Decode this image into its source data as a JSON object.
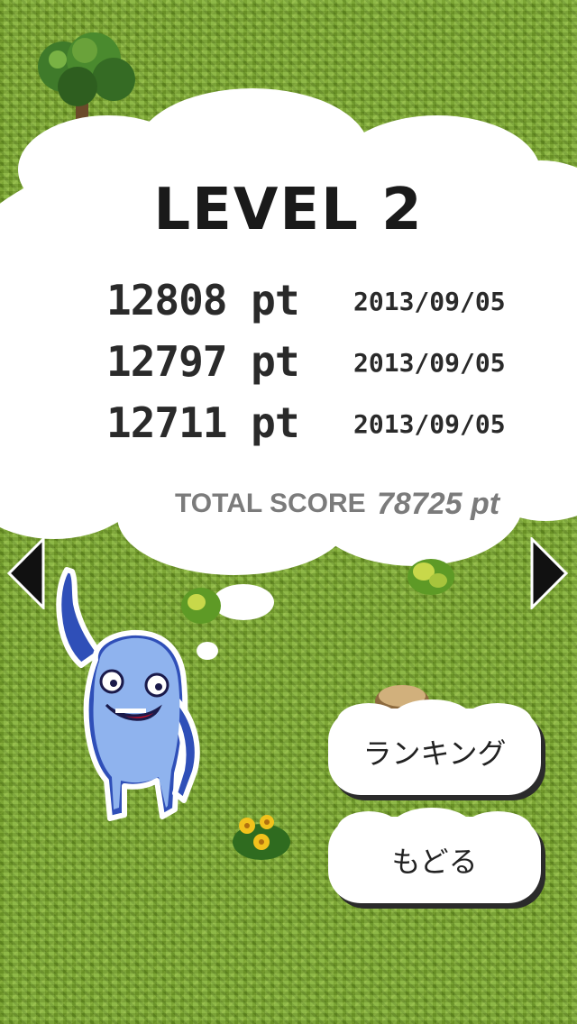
{
  "level": {
    "title": "LEVEL 2"
  },
  "scores": [
    {
      "value": "12808 pt",
      "date": "2013/09/05"
    },
    {
      "value": "12797 pt",
      "date": "2013/09/05"
    },
    {
      "value": "12711 pt",
      "date": "2013/09/05"
    }
  ],
  "total": {
    "label": "TOTAL SCORE",
    "value": "78725 pt"
  },
  "buttons": {
    "ranking": "ランキング",
    "back": "もどる"
  },
  "icons": {
    "prev": "triangle-left-icon",
    "next": "triangle-right-icon"
  }
}
